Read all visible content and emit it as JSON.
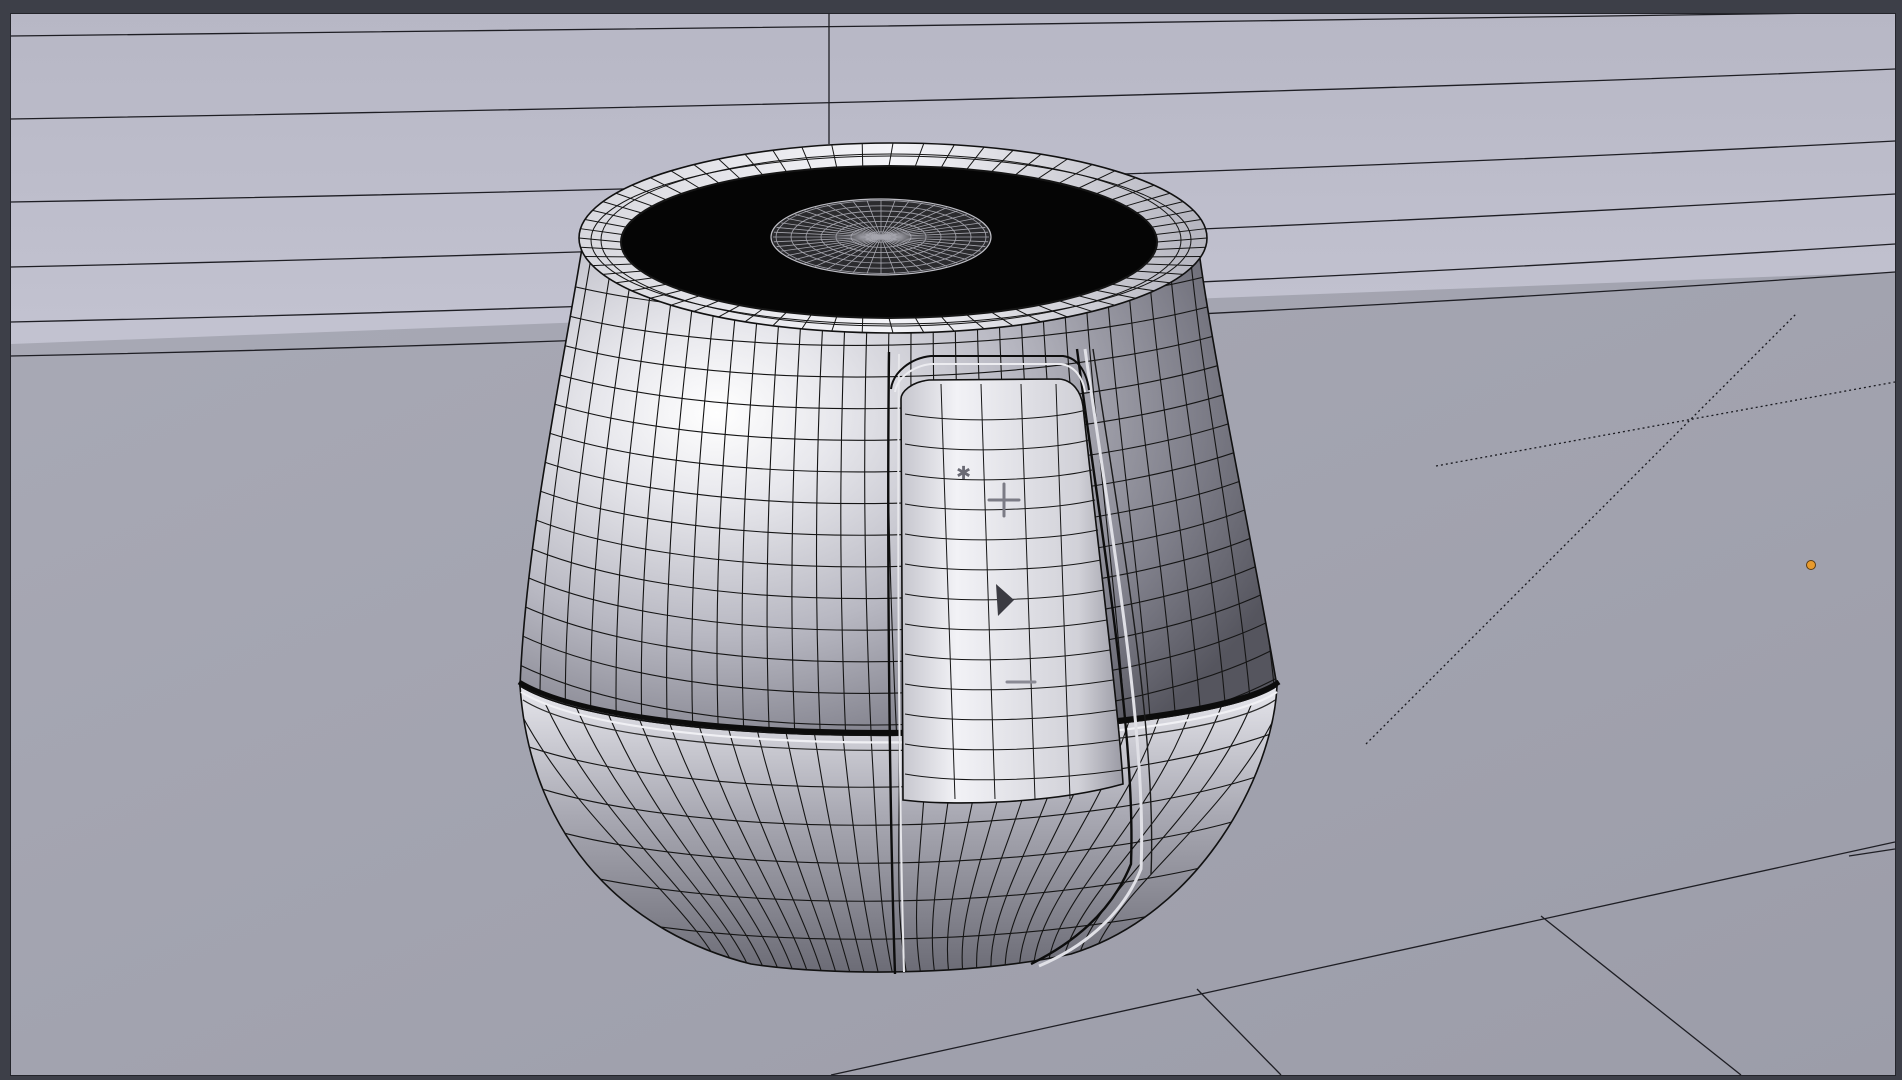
{
  "app": {
    "panel": "3d-viewport",
    "shading": "solid-with-wireframe"
  },
  "scene": {
    "object": "speaker-mesh",
    "buttons": [
      "plus-icon",
      "play-icon",
      "minus-icon"
    ],
    "light": "light-point-icon"
  },
  "colors": {
    "frame": "#3d3f48",
    "wall": "#c3c3d2",
    "floor": "#a1a2ae",
    "body_light": "#f2f2f6",
    "body_mid": "#c8c8d0",
    "body_dark": "#6f6f78",
    "rim_interior": "#050505",
    "wire": "#111111",
    "light_point": "#e89a2c"
  }
}
